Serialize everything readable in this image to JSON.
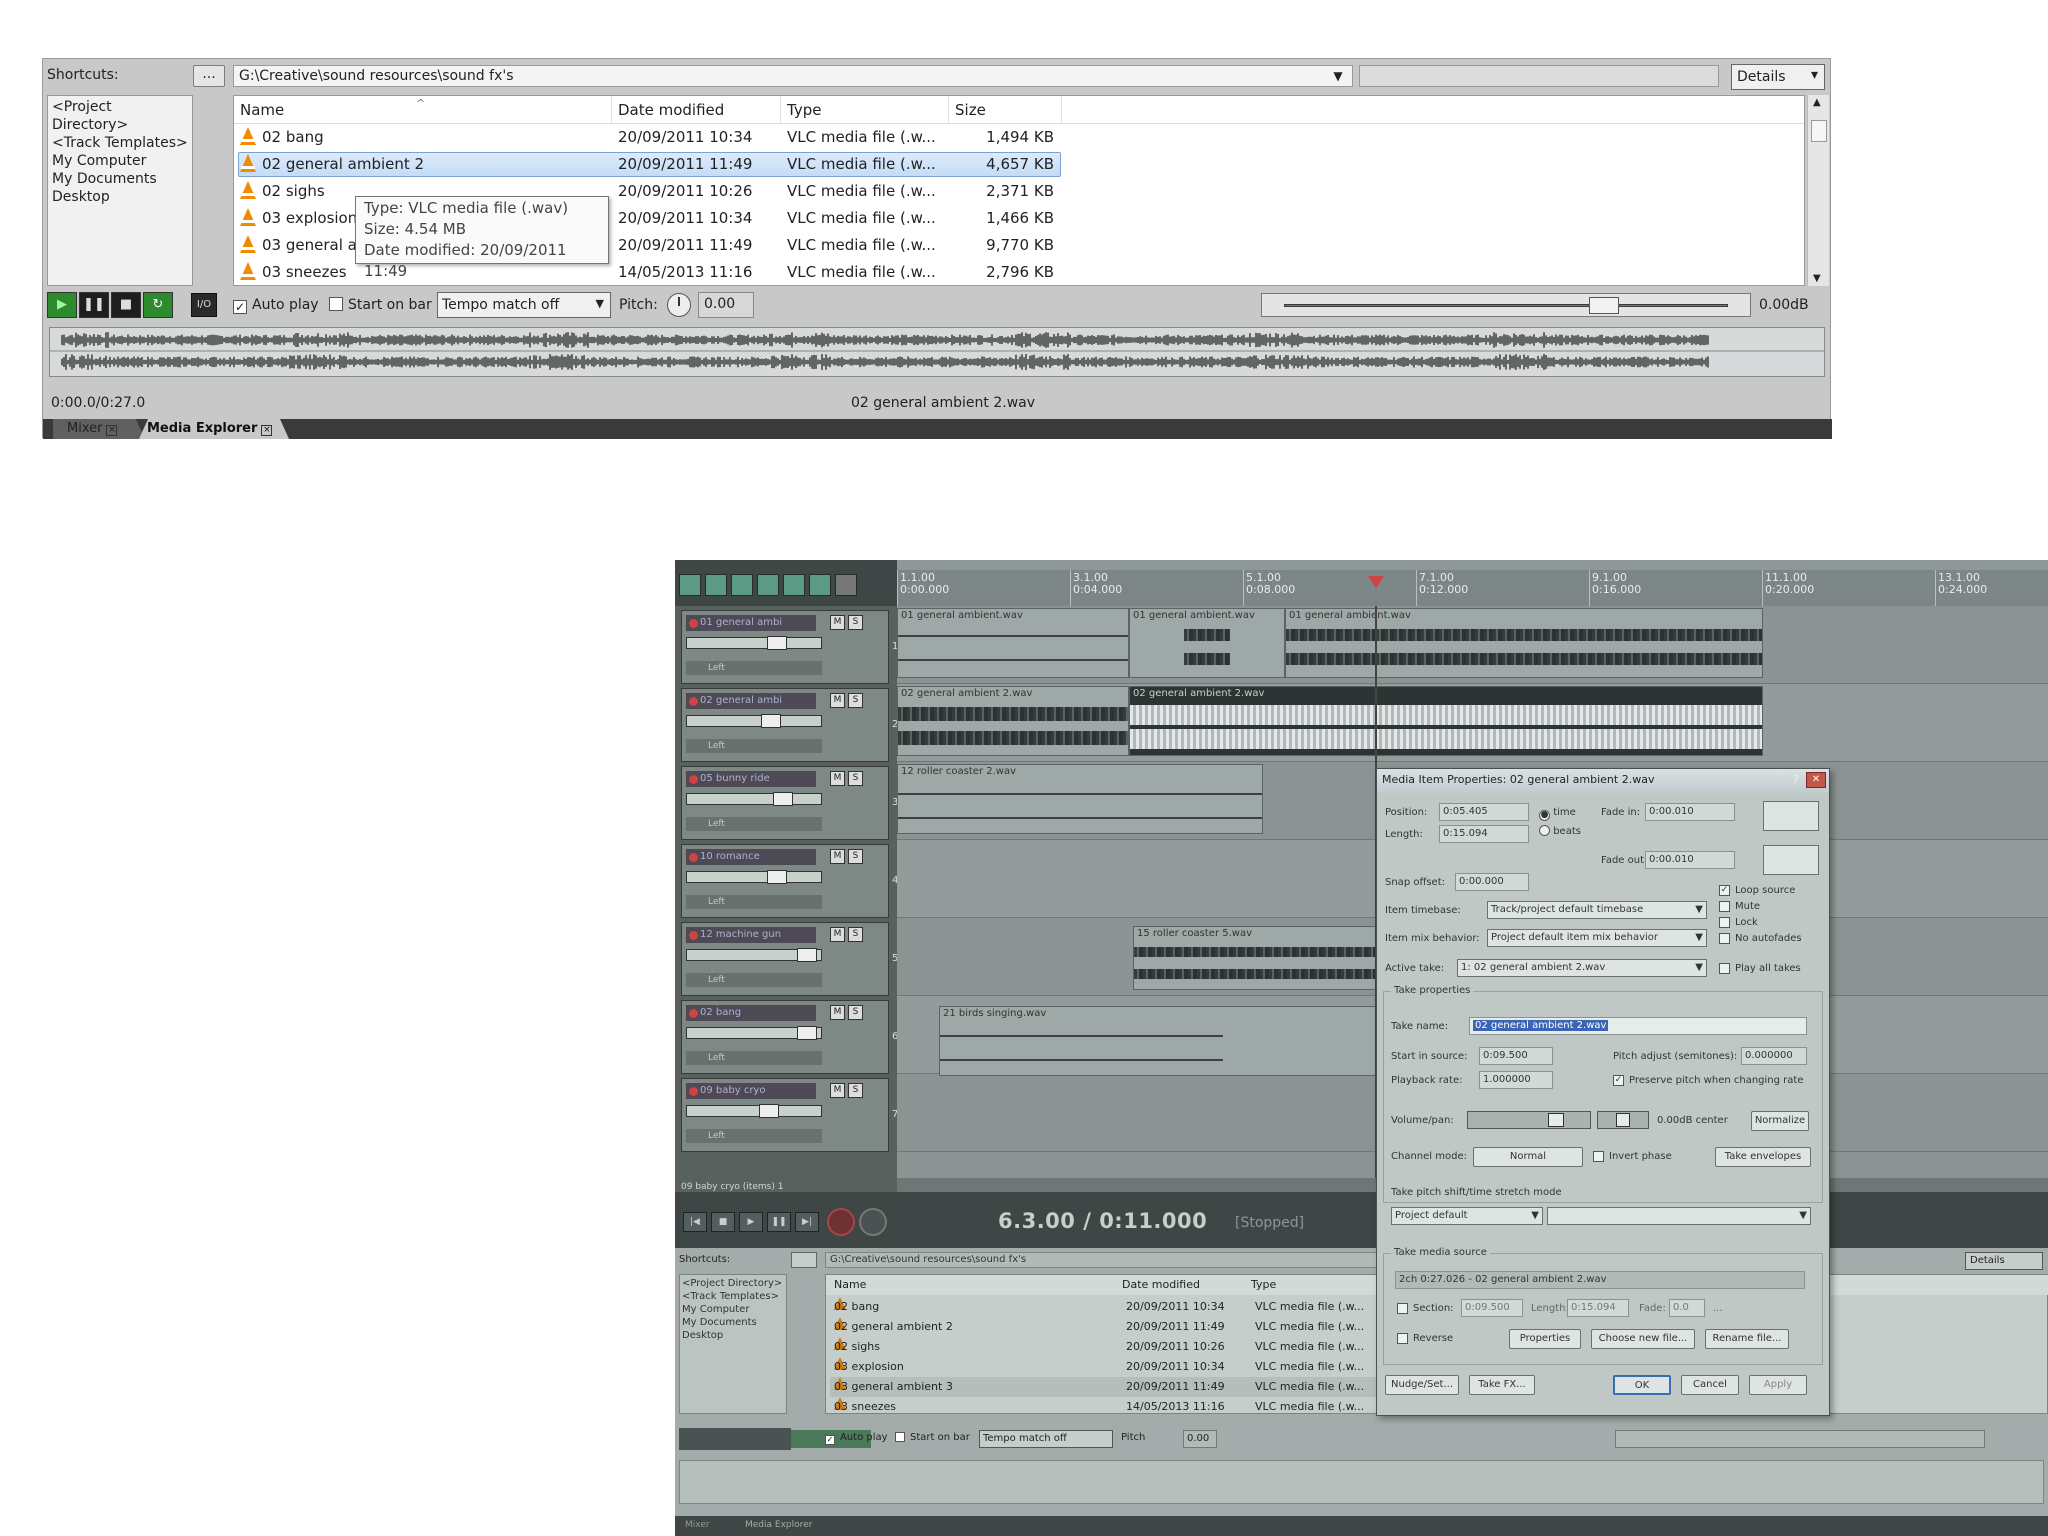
{
  "media_explorer": {
    "shortcuts_label": "Shortcuts:",
    "browse_button": "...",
    "path": "G:\\Creative\\sound resources\\sound fx's",
    "path_dropdown_icon": "chevron-down-icon",
    "view_mode": "Details",
    "shortcuts": [
      "<Project Directory>",
      "<Track Templates>",
      "My Computer",
      "My Documents",
      "Desktop"
    ],
    "columns": [
      "Name",
      "Date modified",
      "Type",
      "Size"
    ],
    "files": [
      {
        "name": "02 bang",
        "date": "20/09/2011 10:34",
        "type": "VLC media file (.w...",
        "size": "1,494 KB"
      },
      {
        "name": "02 general ambient 2",
        "date": "20/09/2011 11:49",
        "type": "VLC media file (.w...",
        "size": "4,657 KB"
      },
      {
        "name": "02 sighs",
        "date": "20/09/2011 10:26",
        "type": "VLC media file (.w...",
        "size": "2,371 KB"
      },
      {
        "name": "03 explosion",
        "date": "20/09/2011 10:34",
        "type": "VLC media file (.w...",
        "size": "1,466 KB"
      },
      {
        "name": "03 general ambient 3",
        "date": "20/09/2011 11:49",
        "type": "VLC media file (.w...",
        "size": "9,770 KB"
      },
      {
        "name": "03 sneezes",
        "date": "14/05/2013 11:16",
        "type": "VLC media file (.w...",
        "size": "2,796 KB"
      }
    ],
    "selected_index": 1,
    "tooltip": {
      "type_line": "Type: VLC media file (.wav)",
      "size_line": "Size: 4.54 MB",
      "date_line": "Date modified: 20/09/2011 11:49"
    },
    "transport": {
      "play": "▶",
      "pause": "❚❚",
      "stop": "■",
      "loop": "↻"
    },
    "io_label": "I/O",
    "autoplay_label": "Auto play",
    "autoplay_checked": true,
    "start_on_bar_label": "Start on bar",
    "start_on_bar_checked": false,
    "tempo_mode": "Tempo match off",
    "pitch_label": "Pitch:",
    "pitch_value": "0.00",
    "volume_value": "0.00dB",
    "volume_level": 0.72,
    "time_position": "0:00.0/0:27.0",
    "preview_file": "02 general ambient 2.wav",
    "tabs": [
      "Mixer",
      "Media Explorer"
    ],
    "active_tab": "Media Explorer"
  },
  "daw": {
    "ruler": [
      {
        "bar": "1.1.00",
        "time": "0:00.000"
      },
      {
        "bar": "3.1.00",
        "time": "0:04.000"
      },
      {
        "bar": "5.1.00",
        "time": "0:08.000"
      },
      {
        "bar": "7.1.00",
        "time": "0:12.000"
      },
      {
        "bar": "9.1.00",
        "time": "0:16.000"
      },
      {
        "bar": "11.1.00",
        "time": "0:20.000"
      },
      {
        "bar": "13.1.00",
        "time": "0:24.000"
      }
    ],
    "tracks": [
      {
        "num": "1",
        "name": "01 general ambi"
      },
      {
        "num": "2",
        "name": "02 general ambi"
      },
      {
        "num": "3",
        "name": "05 bunny ride"
      },
      {
        "num": "4",
        "name": "10 romance"
      },
      {
        "num": "5",
        "name": "12 machine gun"
      },
      {
        "num": "6",
        "name": "02 bang"
      },
      {
        "num": "7",
        "name": "09 baby cryo"
      }
    ],
    "items": [
      {
        "label": "01 general ambient.wav"
      },
      {
        "label": "01 general ambient.wav"
      },
      {
        "label": "01 general ambient.wav"
      },
      {
        "label": "02 general ambient 2.wav"
      },
      {
        "label": "02 general ambient 2.wav"
      },
      {
        "label": "12 roller coaster 2.wav"
      },
      {
        "label": "15 roller coaster 5.wav"
      },
      {
        "label": "21 birds singing.wav"
      }
    ],
    "status_track": "09 baby cryo (items) 1",
    "transport_time": "6.3.00 / 0:11.000",
    "transport_state": "[Stopped]",
    "pan_label": "Left",
    "me_path": "G:\\Creative\\sound resources\\sound fx's",
    "me_view": "Details",
    "me_columns": [
      "Name",
      "Date modified",
      "Type"
    ],
    "me_files": [
      {
        "name": "02 bang",
        "date": "20/09/2011 10:34",
        "type": "VLC media file (.w..."
      },
      {
        "name": "02 general ambient 2",
        "date": "20/09/2011 11:49",
        "type": "VLC media file (.w..."
      },
      {
        "name": "02 sighs",
        "date": "20/09/2011 10:26",
        "type": "VLC media file (.w..."
      },
      {
        "name": "03 explosion",
        "date": "20/09/2011 10:34",
        "type": "VLC media file (.w..."
      },
      {
        "name": "03 general ambient 3",
        "date": "20/09/2011 11:49",
        "type": "VLC media file (.w..."
      },
      {
        "name": "03 sneezes",
        "date": "14/05/2013 11:16",
        "type": "VLC media file (.w..."
      }
    ],
    "me_shortcuts": [
      "<Project Directory>",
      "<Track Templates>",
      "My Computer",
      "My Documents",
      "Desktop"
    ],
    "me_tempo": "Tempo match off",
    "me_autoplay": "Auto play",
    "me_startonbar": "Start on bar",
    "me_pitch_label": "Pitch",
    "me_pitch": "0.00",
    "me_tabs": [
      "Mixer",
      "Media Explorer"
    ]
  },
  "dialog": {
    "title": "Media Item Properties: 02 general ambient 2.wav",
    "position_label": "Position:",
    "position": "0:05.405",
    "length_label": "Length:",
    "length": "0:15.094",
    "time_label": "time",
    "beats_label": "beats",
    "fade_in_label": "Fade in:",
    "fade_in": "0:00.010",
    "fade_out_label": "Fade out:",
    "fade_out": "0:00.010",
    "snap_offset_label": "Snap offset:",
    "snap_offset": "0:00.000",
    "item_timebase_label": "Item timebase:",
    "item_timebase": "Track/project default timebase",
    "item_mix_label": "Item mix behavior:",
    "item_mix": "Project default item mix behavior",
    "active_take_label": "Active take:",
    "active_take": "1: 02 general ambient 2.wav",
    "loop_source_label": "Loop source",
    "mute_label": "Mute",
    "lock_label": "Lock",
    "no_autofades_label": "No autofades",
    "play_all_takes_label": "Play all takes",
    "take_props_label": "Take properties",
    "take_name_label": "Take name:",
    "take_name": "02 general ambient 2.wav",
    "start_in_source_label": "Start in source:",
    "start_in_source": "0:09.500",
    "pitch_adjust_label": "Pitch adjust (semitones):",
    "pitch_adjust": "0.000000",
    "playback_rate_label": "Playback rate:",
    "playback_rate": "1.000000",
    "preserve_pitch_label": "Preserve pitch when changing rate",
    "volume_pan_label": "Volume/pan:",
    "volume_pan_value": "0.00dB center",
    "normalize_label": "Normalize",
    "channel_mode_label": "Channel mode:",
    "channel_mode": "Normal",
    "invert_phase_label": "Invert phase",
    "take_envelopes_label": "Take envelopes",
    "stretch_group_label": "Take pitch shift/time stretch mode",
    "stretch_mode": "Project default",
    "media_source_label": "Take media source",
    "media_source": "2ch 0:27.026 - 02 general ambient 2.wav",
    "section_label": "Section:",
    "section_start": "0:09.500",
    "section_length_label": "Length:",
    "section_length": "0:15.094",
    "section_fade_label": "Fade:",
    "section_fade": "0.0",
    "more_button": "...",
    "reverse_label": "Reverse",
    "properties_button": "Properties",
    "choose_new_file_button": "Choose new file...",
    "rename_file_button": "Rename file...",
    "nudge_button": "Nudge/Set...",
    "take_fx_button": "Take FX...",
    "ok_button": "OK",
    "cancel_button": "Cancel",
    "apply_button": "Apply"
  }
}
